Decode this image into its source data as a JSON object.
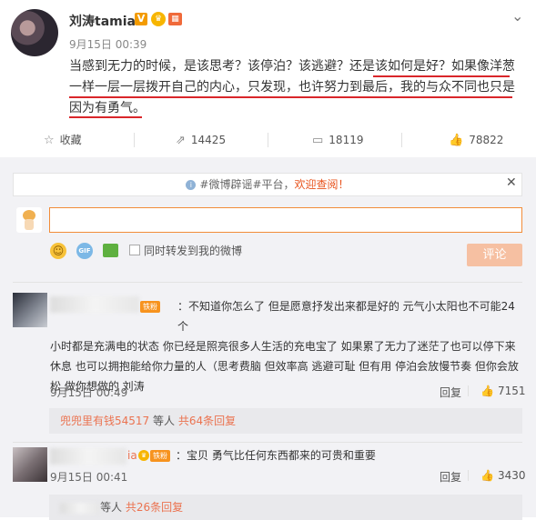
{
  "post": {
    "username": "刘涛tamia",
    "verified_badge": "V",
    "date": "9月15日 00:39",
    "text_line1": "当感到无力的时候，是该思考？该停泊？该逃避？还是该如何是好？如果像洋葱",
    "text_line2": "一样一层一层拨开自己的内心，只发现，也许努力到最后，我的与众不同也只是",
    "text_line3": "因为有勇气。"
  },
  "actions": {
    "favorite": "收藏",
    "repost": "14425",
    "comment": "18119",
    "like": "78822"
  },
  "notice": {
    "prefix": "#微博辟谣#平台，",
    "highlight": "欢迎查阅！"
  },
  "composer": {
    "forward_label": "同时转发到我的微博",
    "submit_label": "评论",
    "gif_label": "GIF"
  },
  "comments": [
    {
      "badge": "铁粉",
      "text_line1": "：不知道你怎么了 但是愿意抒发出来都是好的 元气小太阳也不可能24个",
      "text_line2": "小时都是充满电的状态 你已经是照亮很多人生活的充电宝了 如果累了无力了迷茫了也可以停下来",
      "text_line3": "休息 也可以拥抱能给你力量的人（思考费脑 但效率高 逃避可耻 但有用 停泊会放慢节奏 但你会放",
      "text_line4": "松 做你想做的 刘涛",
      "date": "9月15日 00:49",
      "reply": "回复",
      "likes": "7151",
      "sub_user": "兜兜里有钱54517",
      "sub_mid": " 等人 ",
      "sub_count": "共64条回复"
    },
    {
      "name_suffix": "ia",
      "badge": "铁粉",
      "text": "：宝贝 勇气比任何东西都来的可贵和重要",
      "date": "9月15日 00:41",
      "reply": "回复",
      "likes": "3430",
      "sub_mid": "等人 ",
      "sub_count": "共26条回复"
    }
  ]
}
